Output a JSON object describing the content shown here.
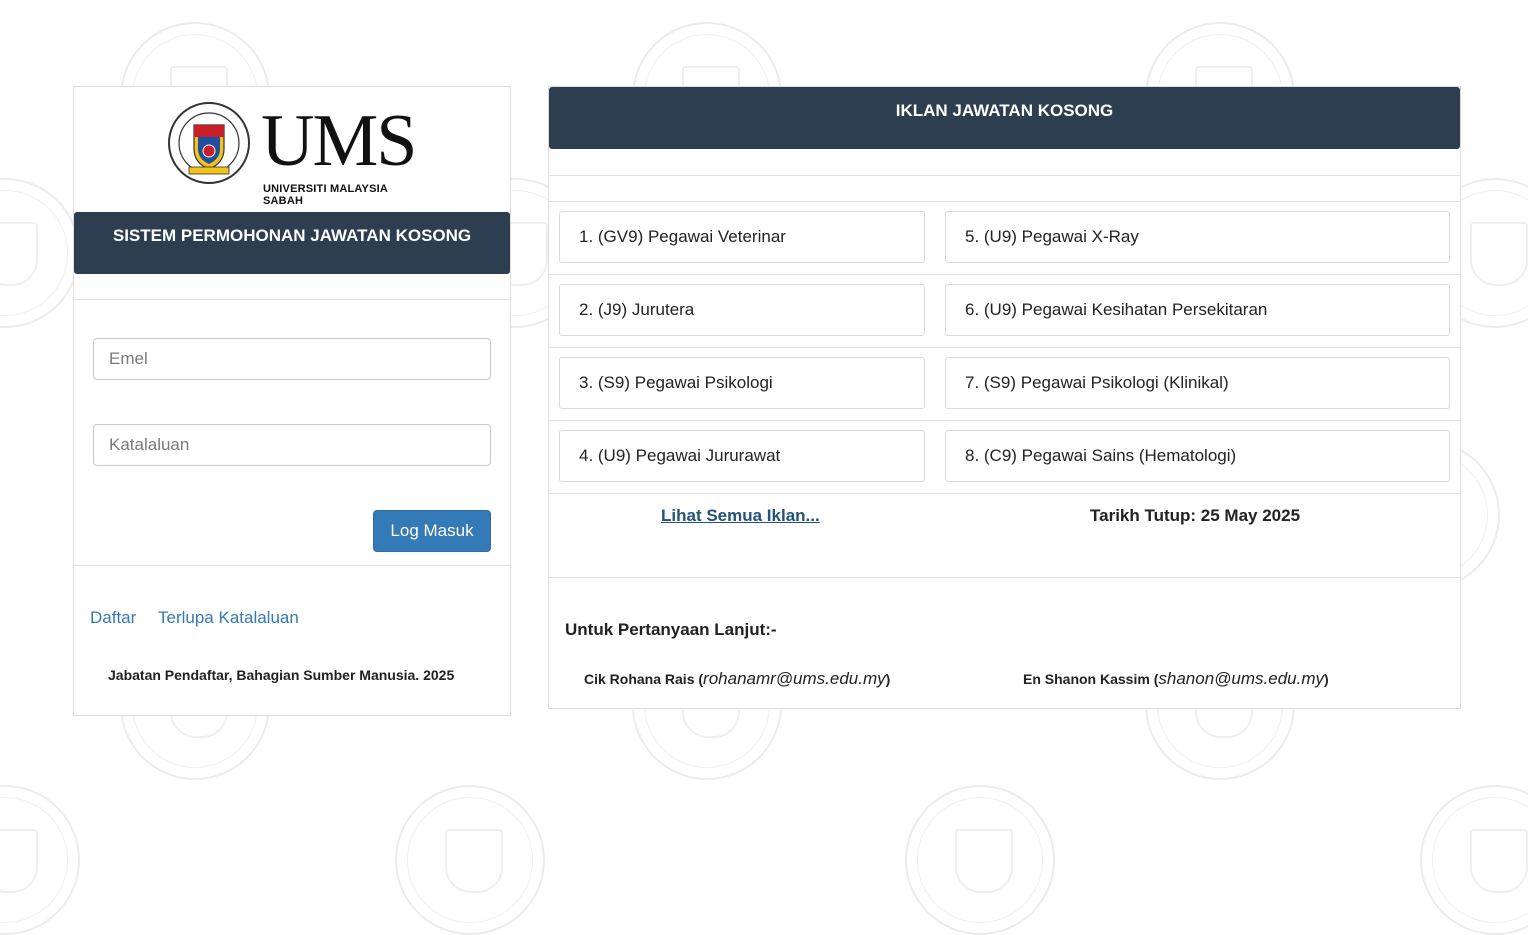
{
  "login": {
    "logo_text": "UMS",
    "logo_subtitle": "UNIVERSITI MALAYSIA SABAH",
    "system_title": "SISTEM PERMOHONAN JAWATAN KOSONG",
    "email_placeholder": "Emel",
    "password_placeholder": "Katalaluan",
    "login_button": "Log Masuk",
    "register_link": "Daftar",
    "forgot_link": "Terlupa Katalaluan",
    "footer": "Jabatan Pendaftar, Bahagian Sumber Manusia. 2025"
  },
  "jobs": {
    "title": "IKLAN JAWATAN KOSONG",
    "items": [
      "1. (GV9) Pegawai Veterinar",
      "2. (J9) Jurutera",
      "3. (S9) Pegawai Psikologi",
      "4. (U9) Pegawai Jururawat",
      "5. (U9) Pegawai X-Ray",
      "6. (U9) Pegawai Kesihatan Persekitaran",
      "7. (S9) Pegawai Psikologi (Klinikal)",
      "8. (C9) Pegawai Sains (Hematologi)"
    ],
    "view_all_link": "Lihat Semua Iklan...",
    "closing_date": "Tarikh Tutup: 25 May 2025",
    "enquiry_title": "Untuk Pertanyaan Lanjut:-",
    "contacts": [
      {
        "name": "Cik Rohana Rais",
        "email": "rohanamr@ums.edu.my"
      },
      {
        "name": "En Shanon Kassim",
        "email": "shanon@ums.edu.my"
      }
    ]
  },
  "colors": {
    "header_bg": "#2c3e50",
    "primary": "#337ab7",
    "link_dark": "#23527c"
  }
}
